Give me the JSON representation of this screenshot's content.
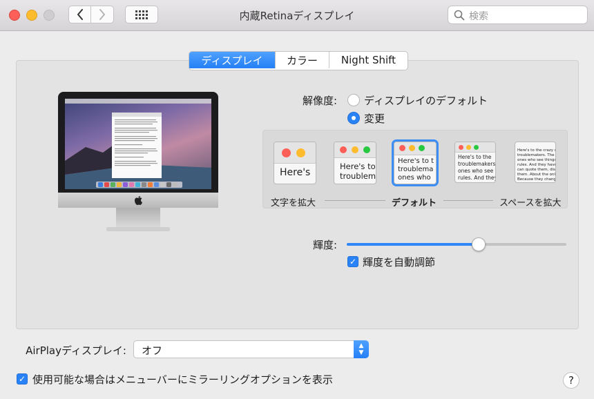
{
  "window": {
    "title": "内蔵Retinaディスプレイ"
  },
  "search": {
    "placeholder": "検索"
  },
  "tabs": [
    {
      "label": "ディスプレイ",
      "active": true
    },
    {
      "label": "カラー",
      "active": false
    },
    {
      "label": "Night Shift",
      "active": false
    }
  ],
  "resolution": {
    "label": "解像度:",
    "options": [
      {
        "label": "ディスプレイのデフォルト",
        "selected": false
      },
      {
        "label": "変更",
        "selected": true
      }
    ],
    "scaled": {
      "thumbs": [
        {
          "text": "Here's"
        },
        {
          "text": "Here's to\ntroublem"
        },
        {
          "text": "Here's to t\ntroublema\nones who"
        },
        {
          "text": "Here's to the\ntroublemakers.\nones who see t\nrules. And they"
        },
        {
          "text": "Here's to the crazy ones\ntroublemakers. The rou\nones who see things diff\nrules. And they have no\ncan quote them, disagr\nthem. About the only th\nBecause they change t"
        }
      ],
      "selected_index": 2,
      "left_label": "文字を拡大",
      "center_label": "デフォルト",
      "right_label": "スペースを拡大"
    }
  },
  "brightness": {
    "label": "輝度:",
    "level": 0.6,
    "auto_label": "輝度を自動調節",
    "auto_checked": true
  },
  "airplay": {
    "label": "AirPlayディスプレイ:",
    "value": "オフ"
  },
  "mirroring": {
    "label": "使用可能な場合はメニューバーにミラーリングオプションを表示",
    "checked": true
  },
  "help": {
    "label": "?"
  },
  "colors": {
    "accent": "#2a83f6",
    "close": "#fc5f57",
    "minimize": "#fdbc2e",
    "zoom": "#28c840"
  },
  "icons": {
    "back": "chevron-left-icon",
    "forward": "chevron-right-icon",
    "grid": "grid-icon",
    "search": "search-icon",
    "apple": "apple-logo-icon"
  }
}
